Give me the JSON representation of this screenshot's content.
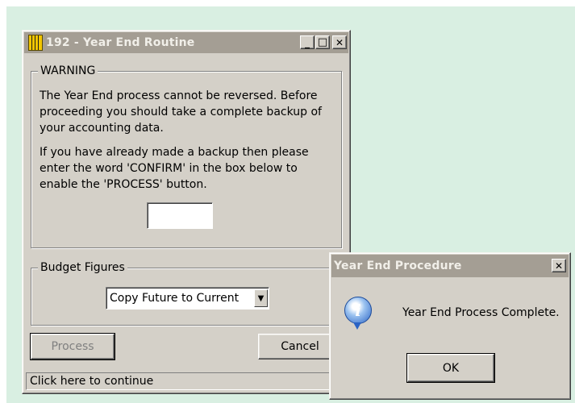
{
  "main_window": {
    "title": "192 - Year End Routine",
    "title_buttons": {
      "minimize": "_",
      "maximize": "□",
      "close": "✕"
    },
    "warning_group": {
      "label": "WARNING",
      "paragraph1": "The Year End process cannot be reversed. Before proceeding you should take a complete backup of your accounting data.",
      "paragraph2": "If you have already made a backup then please enter the word 'CONFIRM' in the box below to enable the 'PROCESS' button.",
      "confirm_input_value": ""
    },
    "budget_group": {
      "label": "Budget Figures",
      "selected": "Copy Future to Current",
      "arrow": "▼"
    },
    "process_button": "Process",
    "cancel_button": "Cancel",
    "status_text": "Click here to continue"
  },
  "dialog": {
    "title": "Year End Procedure",
    "close": "✕",
    "icon": "info-icon",
    "icon_glyph": "i",
    "message": "Year End Process Complete.",
    "ok_button": "OK"
  }
}
